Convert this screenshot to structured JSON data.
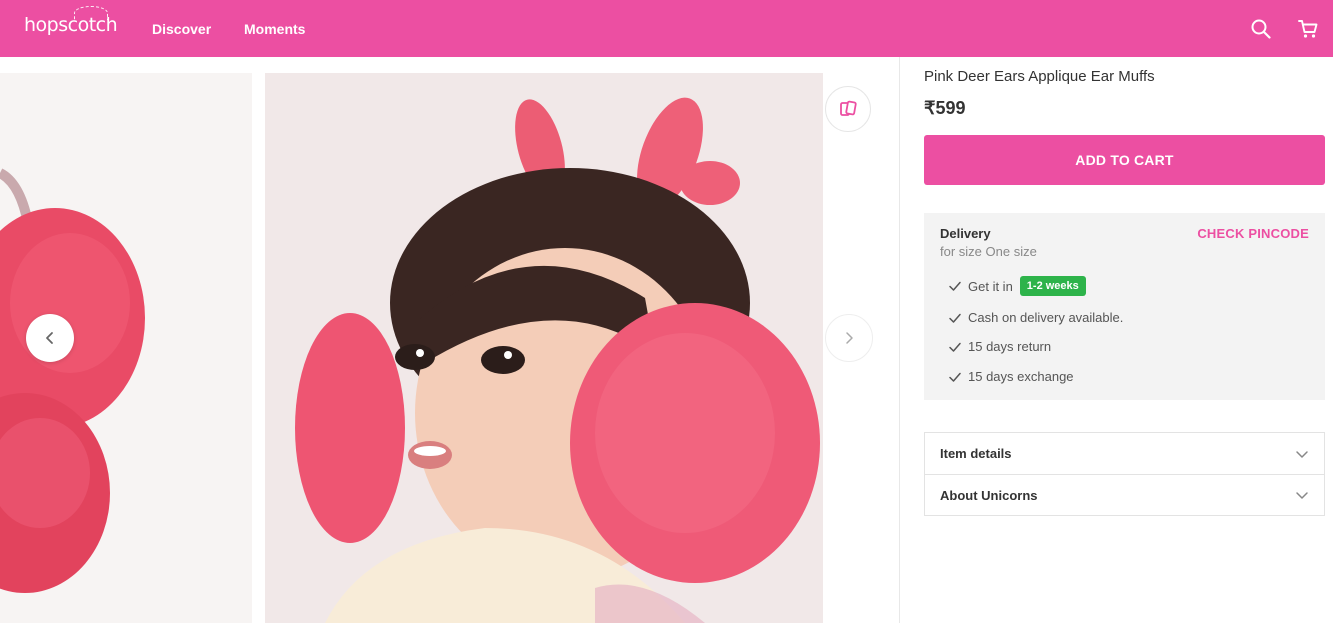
{
  "header": {
    "logo": "hopscotch",
    "nav": [
      {
        "label": "Discover"
      },
      {
        "label": "Moments"
      }
    ],
    "icons": [
      "search-icon",
      "cart-icon"
    ]
  },
  "gallery": {
    "icons": [
      "chevron-left-icon",
      "chevron-right-icon",
      "lookbook-icon"
    ]
  },
  "product": {
    "title": "Pink Deer Ears Applique Ear Muffs",
    "price": "₹599",
    "add_to_cart_label": "ADD TO CART"
  },
  "delivery": {
    "title": "Delivery",
    "size_text": "for size One size",
    "check_pincode_label": "CHECK PINCODE",
    "get_it_in_label": "Get it in",
    "eta": "1-2 weeks",
    "features": [
      "Cash on delivery available.",
      "15 days return",
      "15 days exchange"
    ]
  },
  "accordion": [
    {
      "label": "Item details"
    },
    {
      "label": "About Unicorns"
    }
  ],
  "colors": {
    "brand_pink": "#ec4fa2",
    "eta_green": "#2db34a",
    "delivery_bg": "#f3f3f3"
  }
}
